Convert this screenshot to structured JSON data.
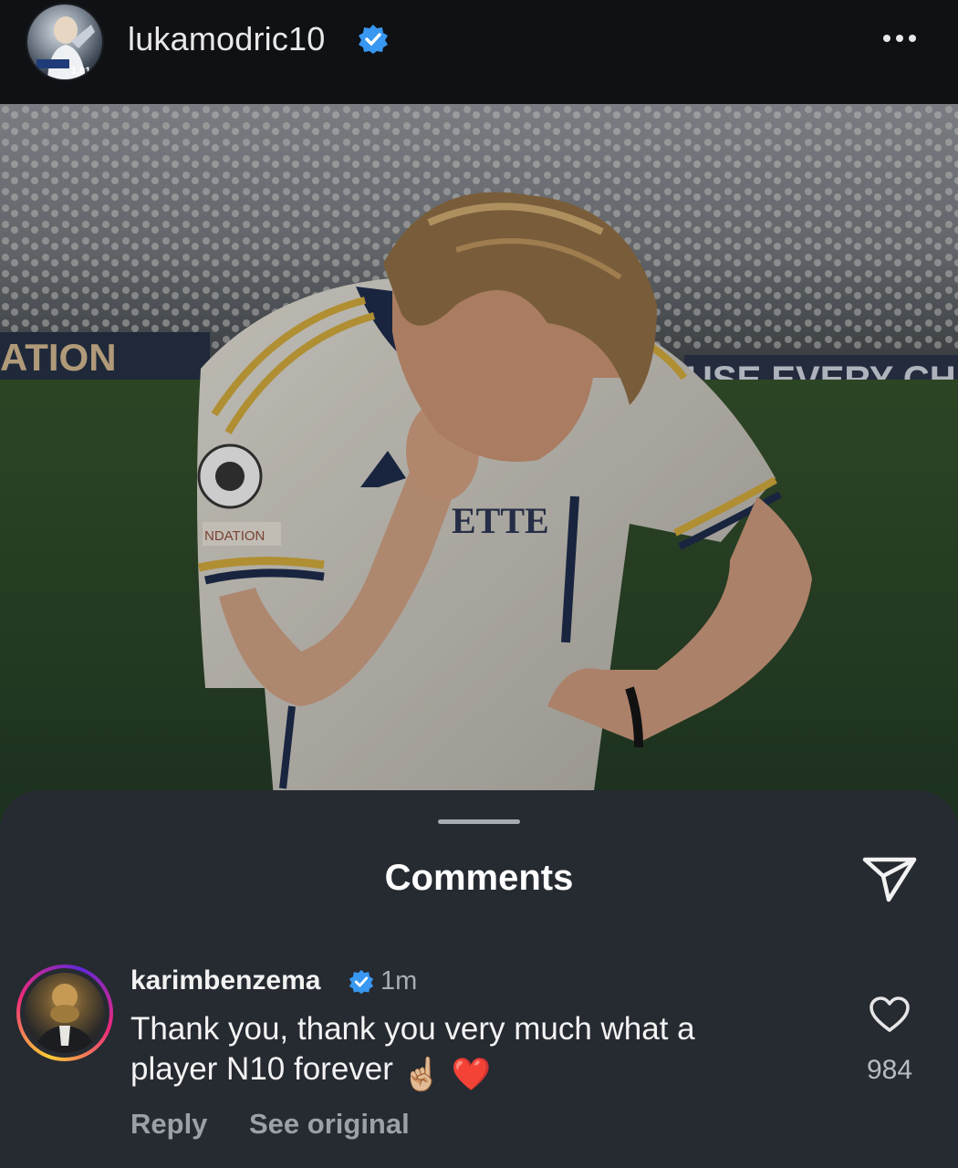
{
  "post": {
    "username": "lukamodric10",
    "verified": true,
    "more_icon": "more-horizontal-icon",
    "photo_banner_left": "ATION",
    "photo_banner_right": "USE EVERY CH",
    "jersey_text": "ETTE",
    "sleeve_badge": "NDATION"
  },
  "comments_sheet": {
    "title": "Comments",
    "share_icon": "paper-plane-icon",
    "comment": {
      "username": "karimbenzema",
      "verified": true,
      "time": "1m",
      "text": "Thank you, thank you very much what a player N10 forever",
      "emojis": [
        "☝🏼",
        "❤️"
      ],
      "like_icon": "heart-outline-icon",
      "like_count": "984",
      "reply_label": "Reply",
      "see_original_label": "See original"
    }
  },
  "colors": {
    "background": "#0f1114",
    "sheet": "#262a31",
    "verified_blue": "#3897f0",
    "muted_text": "#9ca1a8"
  }
}
